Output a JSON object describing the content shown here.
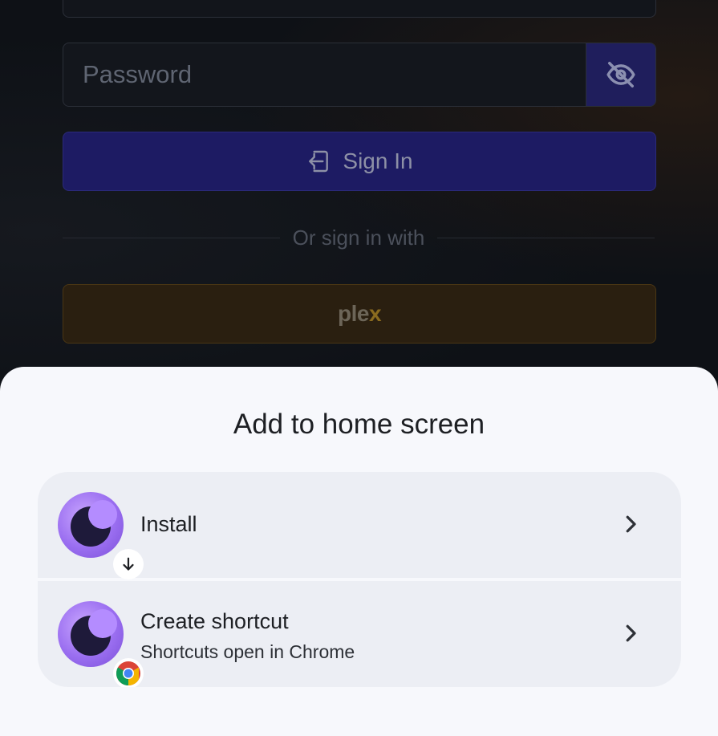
{
  "login": {
    "password_placeholder": "Password",
    "signin_label": "Sign In",
    "divider_text": "Or sign in with",
    "plex_logo": {
      "main": "ple",
      "accent": "x"
    }
  },
  "sheet": {
    "title": "Add to home screen",
    "options": [
      {
        "label": "Install",
        "badge_icon": "download-arrow-icon"
      },
      {
        "label": "Create shortcut",
        "sublabel": "Shortcuts open in Chrome",
        "badge_icon": "chrome-icon"
      }
    ]
  },
  "colors": {
    "primary_button": "#1d1b63",
    "plex_accent": "#e5a00d",
    "sheet_bg": "#f7f8fc",
    "option_bg": "#eceef4"
  }
}
